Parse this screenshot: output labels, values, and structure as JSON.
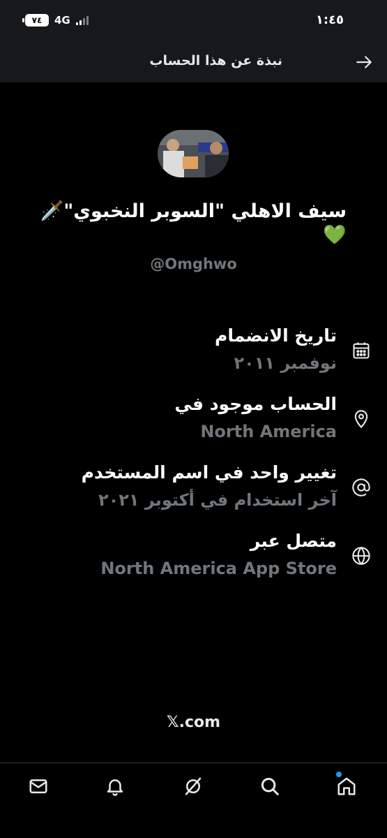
{
  "status_bar": {
    "battery": "٧٤",
    "network": "4G",
    "time": "١:٤٥"
  },
  "header": {
    "title": "نبذة عن هذا الحساب"
  },
  "profile": {
    "display_name": "سيف الاهلي \"السوبر النخبوي\"🗡️💚",
    "handle": "@Omghwo"
  },
  "rows": [
    {
      "icon": "calendar-icon",
      "title": "تاريخ الانضمام",
      "value": "نوفمبر ٢٠١١"
    },
    {
      "icon": "location-pin-icon",
      "title": "الحساب موجود في",
      "value": "North America"
    },
    {
      "icon": "at-sign-icon",
      "title": "تغيير واحد في اسم المستخدم",
      "value": "آخر استخدام في أكتوبر ٢٠٢١"
    },
    {
      "icon": "globe-icon",
      "title": "متصل عبر",
      "value": "North America App Store"
    }
  ],
  "footer": {
    "link": "𝕏.com"
  },
  "bottom_nav": [
    "mail-icon",
    "bell-icon",
    "grok-icon",
    "search-icon",
    "home-icon"
  ],
  "colors": {
    "background": "#000000",
    "header_bg": "#16181c",
    "secondary_text": "#71767b",
    "accent": "#1d9bf0"
  }
}
